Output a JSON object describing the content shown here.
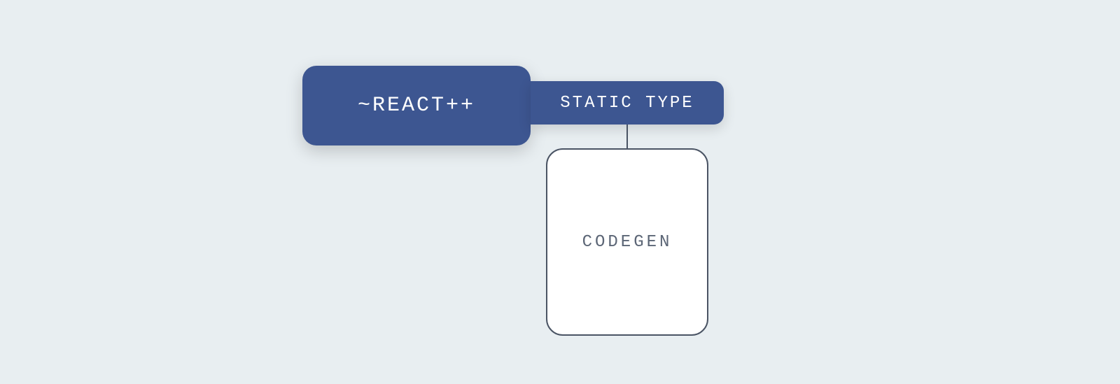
{
  "nodes": {
    "main": {
      "label": "~REACT++"
    },
    "tag": {
      "label": "STATIC TYPE"
    },
    "child": {
      "label": "CODEGEN"
    }
  },
  "colors": {
    "background": "#e8eef1",
    "primary_fill": "#3d5691",
    "primary_text": "#ffffff",
    "outline": "#4a5464",
    "child_fill": "#ffffff",
    "child_text": "#5c6676"
  }
}
